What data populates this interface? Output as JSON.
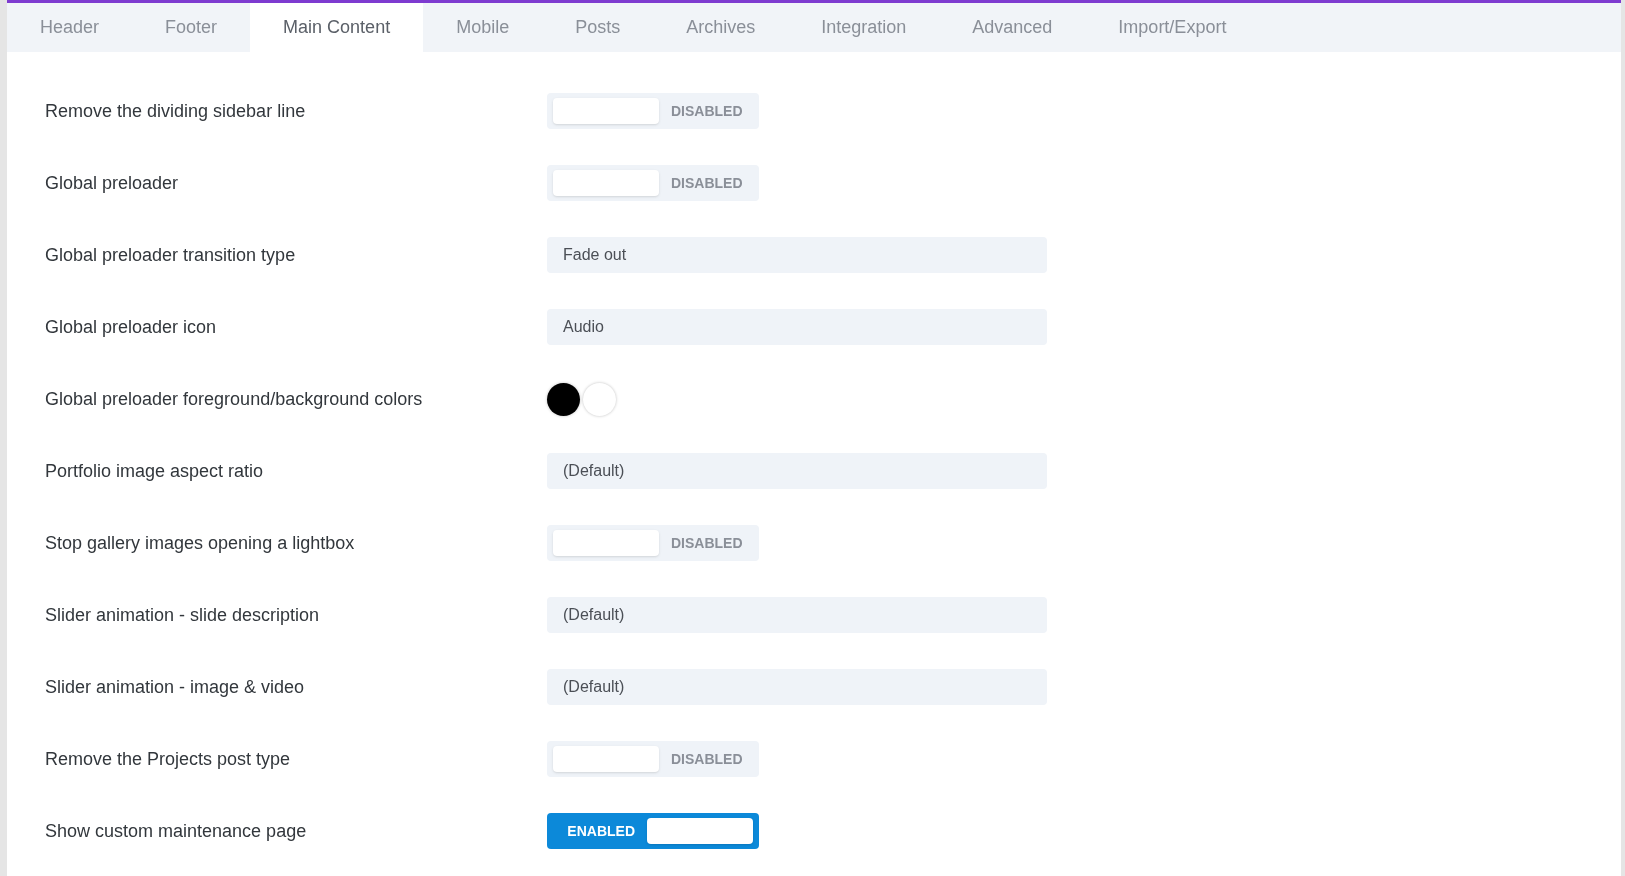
{
  "tabs": [
    {
      "label": "Header",
      "selected": false
    },
    {
      "label": "Footer",
      "selected": false
    },
    {
      "label": "Main Content",
      "selected": true
    },
    {
      "label": "Mobile",
      "selected": false
    },
    {
      "label": "Posts",
      "selected": false
    },
    {
      "label": "Archives",
      "selected": false
    },
    {
      "label": "Integration",
      "selected": false
    },
    {
      "label": "Advanced",
      "selected": false
    },
    {
      "label": "Import/Export",
      "selected": false
    }
  ],
  "settings": [
    {
      "label": "Remove the dividing sidebar line",
      "kind": "toggle",
      "on": false,
      "state_text": "DISABLED"
    },
    {
      "label": "Global preloader",
      "kind": "toggle",
      "on": false,
      "state_text": "DISABLED"
    },
    {
      "label": "Global preloader transition type",
      "kind": "select",
      "value": "Fade out"
    },
    {
      "label": "Global preloader icon",
      "kind": "select",
      "value": "Audio"
    },
    {
      "label": "Global preloader foreground/background colors",
      "kind": "colors",
      "swatches": [
        {
          "color": "#000000"
        },
        {
          "color": "#ffffff"
        }
      ]
    },
    {
      "label": "Portfolio image aspect ratio",
      "kind": "select",
      "value": "(Default)"
    },
    {
      "label": "Stop gallery images opening a lightbox",
      "kind": "toggle",
      "on": false,
      "state_text": "DISABLED"
    },
    {
      "label": "Slider animation - slide description",
      "kind": "select",
      "value": "(Default)"
    },
    {
      "label": "Slider animation - image & video",
      "kind": "select",
      "value": "(Default)"
    },
    {
      "label": "Remove the Projects post type",
      "kind": "toggle",
      "on": false,
      "state_text": "DISABLED"
    },
    {
      "label": "Show custom maintenance page",
      "kind": "toggle",
      "on": true,
      "state_text": "ENABLED"
    }
  ]
}
